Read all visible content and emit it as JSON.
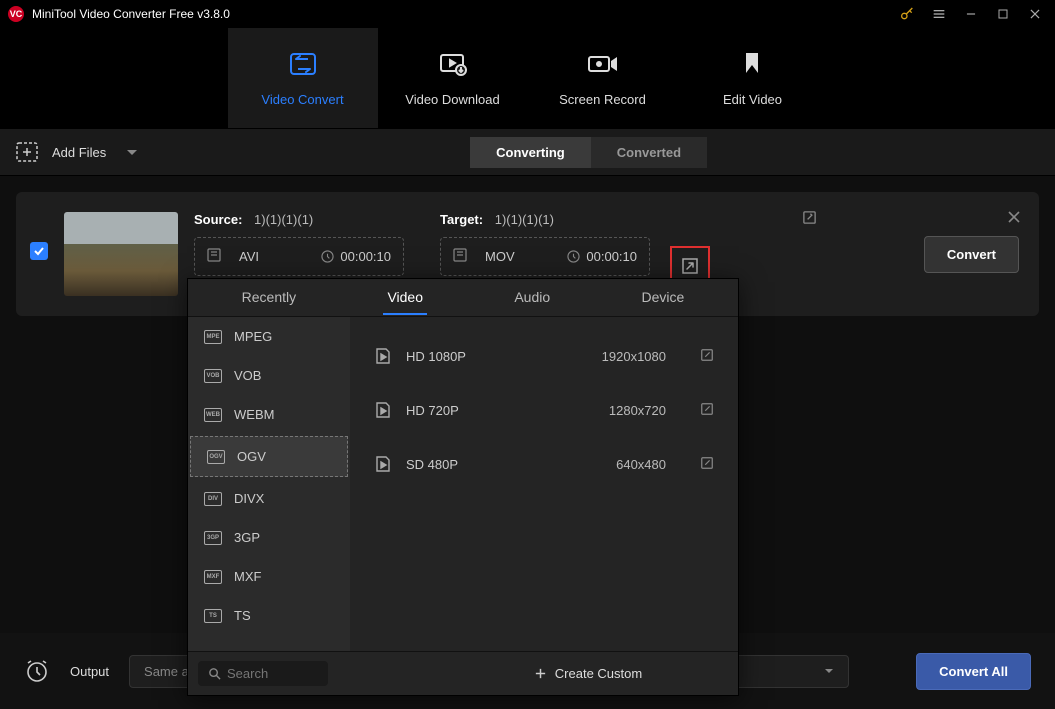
{
  "titlebar": {
    "app_title": "MiniTool Video Converter Free v3.8.0"
  },
  "main_tabs": [
    {
      "label": "Video Convert"
    },
    {
      "label": "Video Download"
    },
    {
      "label": "Screen Record"
    },
    {
      "label": "Edit Video"
    }
  ],
  "toolbar": {
    "add_files": "Add Files",
    "converting": "Converting",
    "converted": "Converted"
  },
  "file": {
    "source_label": "Source:",
    "source_name": "1)(1)(1)(1)",
    "source_fmt": "AVI",
    "source_dur": "00:00:10",
    "target_label": "Target:",
    "target_name": "1)(1)(1)(1)",
    "target_fmt": "MOV",
    "target_dur": "00:00:10",
    "convert_btn": "Convert"
  },
  "popup": {
    "tabs": [
      "Recently",
      "Video",
      "Audio",
      "Device"
    ],
    "formats": [
      "MPEG",
      "VOB",
      "WEBM",
      "OGV",
      "DIVX",
      "3GP",
      "MXF",
      "TS"
    ],
    "selected_format_index": 3,
    "presets": [
      {
        "name": "HD 1080P",
        "res": "1920x1080"
      },
      {
        "name": "HD 720P",
        "res": "1280x720"
      },
      {
        "name": "SD 480P",
        "res": "640x480"
      }
    ],
    "search_placeholder": "Search",
    "create_custom": "Create Custom"
  },
  "bottom": {
    "output_label": "Output",
    "output_value": "Same as",
    "convert_all": "Convert All"
  }
}
